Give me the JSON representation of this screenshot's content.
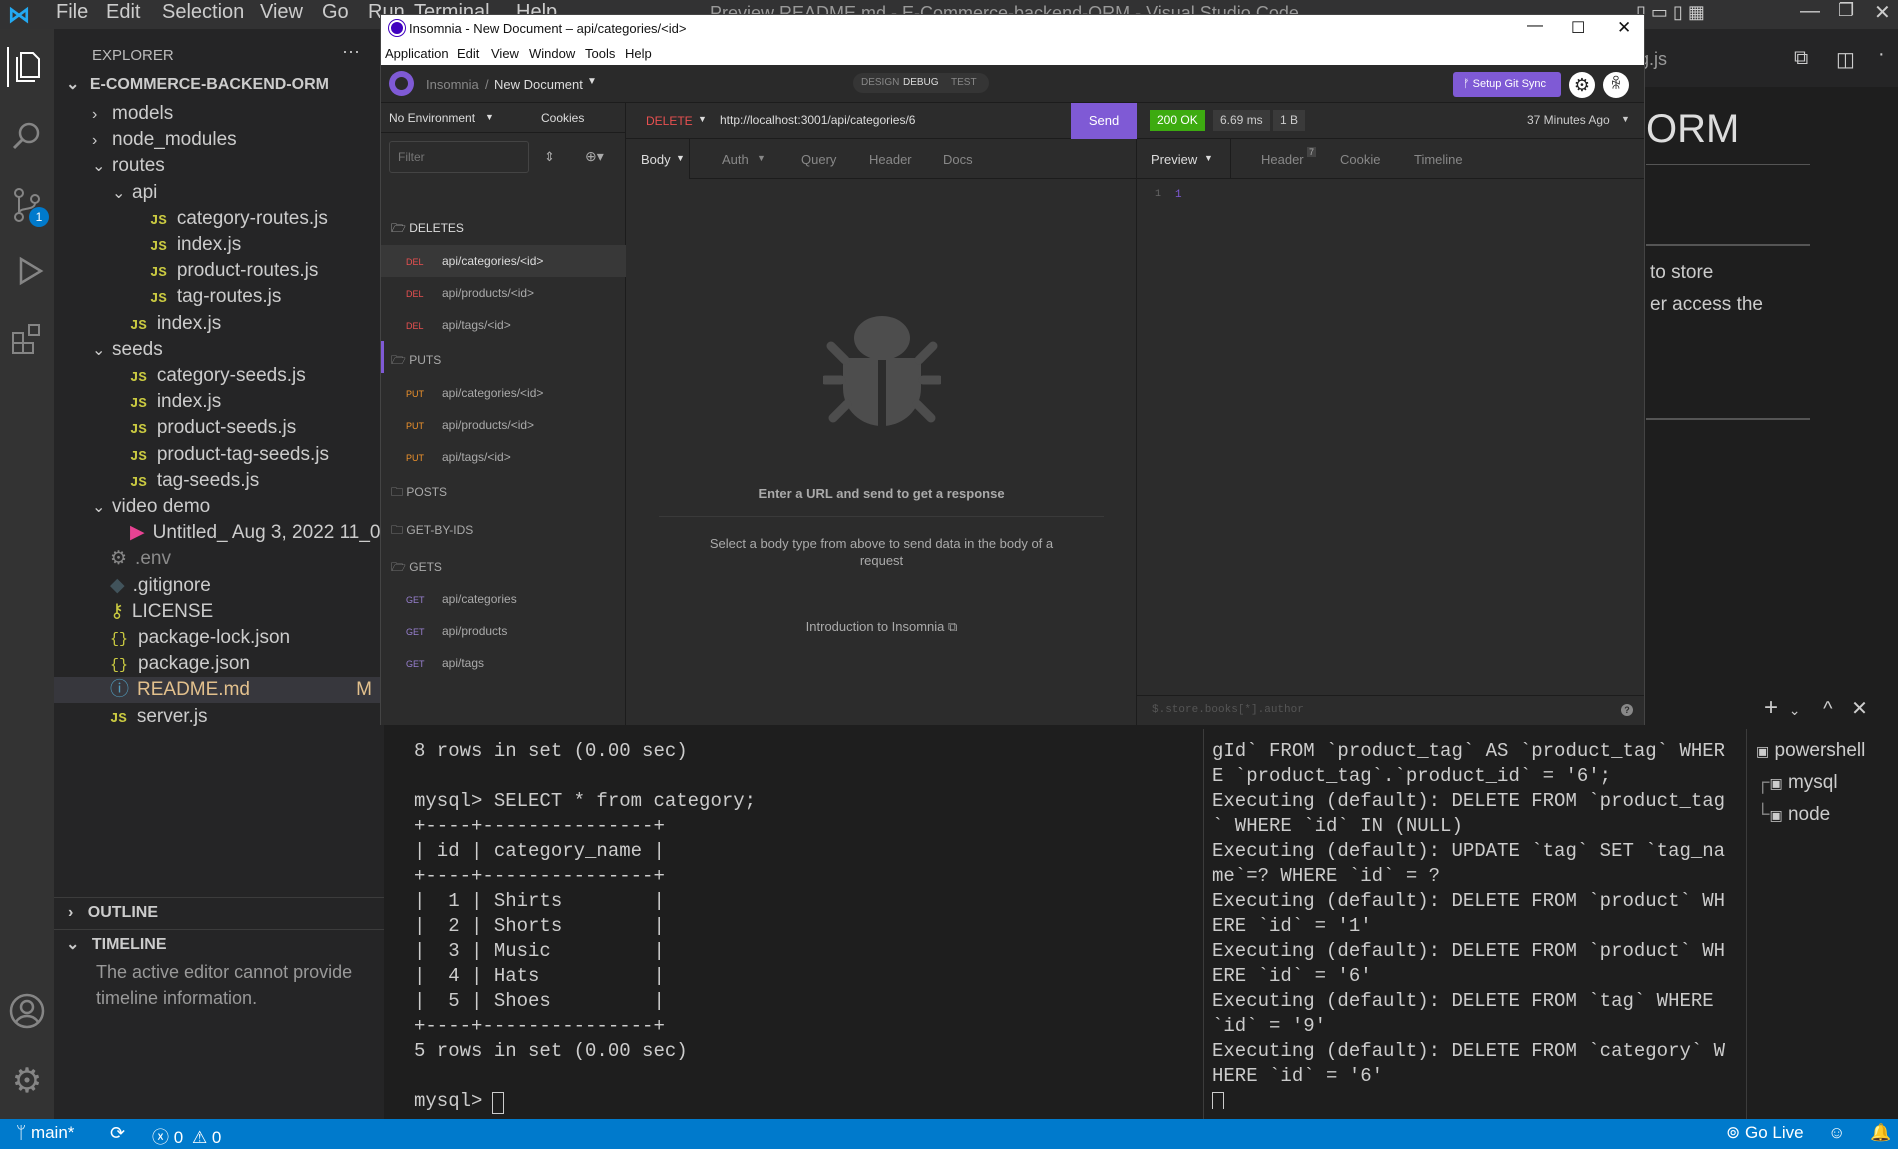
{
  "vscode": {
    "menu": [
      "File",
      "Edit",
      "Selection",
      "View",
      "Go",
      "Run",
      "Terminal",
      "Help"
    ],
    "title": "Preview README.md - E-Commerce-backend-ORM - Visual Studio Code",
    "explorer_label": "EXPLORER",
    "project": "E-COMMERCE-BACKEND-ORM",
    "scm_badge": "1",
    "tree": [
      {
        "label": "models",
        "type": "folder",
        "depth": 1,
        "open": false
      },
      {
        "label": "node_modules",
        "type": "folder",
        "depth": 1,
        "open": false
      },
      {
        "label": "routes",
        "type": "folder",
        "depth": 1,
        "open": true
      },
      {
        "label": "api",
        "type": "folder",
        "depth": 2,
        "open": true
      },
      {
        "label": "category-routes.js",
        "type": "js",
        "depth": 3
      },
      {
        "label": "index.js",
        "type": "js",
        "depth": 3
      },
      {
        "label": "product-routes.js",
        "type": "js",
        "depth": 3
      },
      {
        "label": "tag-routes.js",
        "type": "js",
        "depth": 3
      },
      {
        "label": "index.js",
        "type": "js",
        "depth": 2
      },
      {
        "label": "seeds",
        "type": "folder",
        "depth": 1,
        "open": true
      },
      {
        "label": "category-seeds.js",
        "type": "js",
        "depth": 2
      },
      {
        "label": "index.js",
        "type": "js",
        "depth": 2
      },
      {
        "label": "product-seeds.js",
        "type": "js",
        "depth": 2
      },
      {
        "label": "product-tag-seeds.js",
        "type": "js",
        "depth": 2
      },
      {
        "label": "tag-seeds.js",
        "type": "js",
        "depth": 2
      },
      {
        "label": "video demo",
        "type": "folder",
        "depth": 1,
        "open": true
      },
      {
        "label": "Untitled_ Aug 3, 2022 11_01 P...",
        "type": "video",
        "depth": 2
      },
      {
        "label": ".env",
        "type": "env",
        "depth": 1
      },
      {
        "label": ".gitignore",
        "type": "git",
        "depth": 1
      },
      {
        "label": "LICENSE",
        "type": "license",
        "depth": 1
      },
      {
        "label": "package-lock.json",
        "type": "json",
        "depth": 1
      },
      {
        "label": "package.json",
        "type": "json",
        "depth": 1
      },
      {
        "label": "README.md",
        "type": "md",
        "depth": 1,
        "badge": "M"
      },
      {
        "label": "server.js",
        "type": "js",
        "depth": 1
      }
    ],
    "outline": "OUTLINE",
    "timeline": "TIMELINE",
    "timeline_msg": "The active editor cannot provide timeline information.",
    "editor_tab": "Tag.js",
    "preview_heading": "ORM",
    "preview_line1": "to store",
    "preview_line2": "er access the",
    "terminal_left": [
      "8 rows in set (0.00 sec)",
      "",
      "mysql> SELECT * from category;",
      "+----+---------------+",
      "| id | category_name |",
      "+----+---------------+",
      "|  1 | Shirts        |",
      "|  2 | Shorts        |",
      "|  3 | Music         |",
      "|  4 | Hats          |",
      "|  5 | Shoes         |",
      "+----+---------------+",
      "5 rows in set (0.00 sec)",
      "",
      "mysql> "
    ],
    "terminal_right": [
      "gId` FROM `product_tag` AS `product_tag` WHER",
      "E `product_tag`.`product_id` = '6';",
      "Executing (default): DELETE FROM `product_tag",
      "` WHERE `id` IN (NULL)",
      "Executing (default): UPDATE `tag` SET `tag_na",
      "me`=? WHERE `id` = ?",
      "Executing (default): DELETE FROM `product` WH",
      "ERE `id` = '1'",
      "Executing (default): DELETE FROM `product` WH",
      "ERE `id` = '6'",
      "Executing (default): DELETE FROM `tag` WHERE",
      "`id` = '9'",
      "Executing (default): DELETE FROM `category` W",
      "HERE `id` = '6'"
    ],
    "terminals": [
      "powershell",
      "mysql",
      "node"
    ],
    "status": {
      "branch": "main*",
      "errors": "0",
      "warnings": "0",
      "go_live": "Go Live"
    }
  },
  "insomnia": {
    "title": "Insomnia - New Document – api/categories/<id>",
    "menu": [
      "Application",
      "Edit",
      "View",
      "Window",
      "Tools",
      "Help"
    ],
    "breadcrumb_root": "Insomnia",
    "breadcrumb_sep": "/",
    "document": "New Document",
    "modes": [
      "DESIGN",
      "DEBUG",
      "TEST"
    ],
    "git_sync": "Setup Git Sync",
    "environment": "No Environment",
    "cookies": "Cookies",
    "filter_placeholder": "Filter",
    "groups": {
      "deletes": "DELETES",
      "puts": "PUTS",
      "posts": "POSTS",
      "getbyids": "GET-BY-IDS",
      "gets": "GETS"
    },
    "deletes": [
      {
        "method": "DEL",
        "path": "api/categories/<id>"
      },
      {
        "method": "DEL",
        "path": "api/products/<id>"
      },
      {
        "method": "DEL",
        "path": "api/tags/<id>"
      }
    ],
    "puts": [
      {
        "method": "PUT",
        "path": "api/categories/<id>"
      },
      {
        "method": "PUT",
        "path": "api/products/<id>"
      },
      {
        "method": "PUT",
        "path": "api/tags/<id>"
      }
    ],
    "gets": [
      {
        "method": "GET",
        "path": "api/categories"
      },
      {
        "method": "GET",
        "path": "api/products"
      },
      {
        "method": "GET",
        "path": "api/tags"
      }
    ],
    "request_method": "DELETE",
    "url": "http://localhost:3001/api/categories/6",
    "send": "Send",
    "req_tabs": [
      "Body",
      "Auth",
      "Query",
      "Header",
      "Docs"
    ],
    "empty_title": "Enter a URL and send to get a response",
    "empty_body": "Select a body type from above to send data in the body of a request",
    "intro_link": "Introduction to Insomnia",
    "status_code": "200 OK",
    "time": "6.69 ms",
    "size": "1 B",
    "ago": "37 Minutes Ago",
    "resp_tabs": [
      "Preview",
      "Header",
      "Cookie",
      "Timeline"
    ],
    "header_count": "7",
    "resp_line_no": "1",
    "resp_body": "1",
    "filter_query": "$.store.books[*].author",
    "help": "?",
    "colors": {
      "accent": "#7f5ad5",
      "ok": "#3dab10",
      "delete": "#e85050",
      "put": "#f0932b",
      "get": "#9880d0"
    }
  }
}
